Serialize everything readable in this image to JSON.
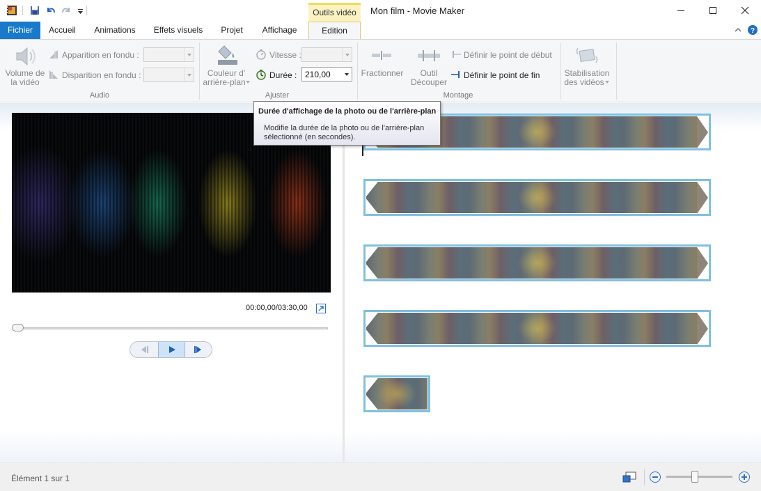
{
  "window": {
    "title": "Mon film - Movie Maker",
    "contextual_group": "Outils vidéo"
  },
  "tabs": [
    {
      "label": "Fichier"
    },
    {
      "label": "Accueil"
    },
    {
      "label": "Animations"
    },
    {
      "label": "Effets visuels"
    },
    {
      "label": "Projet"
    },
    {
      "label": "Affichage"
    },
    {
      "label": "Edition"
    }
  ],
  "ribbon": {
    "audio": {
      "group_label": "Audio",
      "volume_label_1": "Volume de",
      "volume_label_2": "la vidéo",
      "fade_in_label": "Apparition en fondu :",
      "fade_out_label": "Disparition en fondu :"
    },
    "adjust": {
      "group_label": "Ajuster",
      "bg_color_label_1": "Couleur d'",
      "bg_color_label_2": "arrière-plan",
      "speed_label": "Vitesse :",
      "duration_label": "Durée :",
      "duration_value": "210,00"
    },
    "editing": {
      "group_label": "Montage",
      "split_label": "Fractionner",
      "trim_label_1": "Outil",
      "trim_label_2": "Découper",
      "set_start_label": "Définir le point de début",
      "set_end_label": "Définir le point de fin"
    },
    "stabilization": {
      "label_1": "Stabilisation",
      "label_2": "des vidéos"
    }
  },
  "preview": {
    "timecode": "00:00,00/03:30,00",
    "seek_fraction": 0.0
  },
  "tooltip": {
    "title": "Durée d'affichage de la photo ou de l'arrière-plan",
    "body": "Modifie la durée de la photo ou de l'arrière-plan sélectionné (en secondes)."
  },
  "status": {
    "text": "Élément 1 sur 1",
    "zoom_fraction": 0.42
  },
  "colors": {
    "file_tab": "#1979ca",
    "contextual_tab": "#fbf2c2",
    "clip_border": "#7fc0e0"
  }
}
